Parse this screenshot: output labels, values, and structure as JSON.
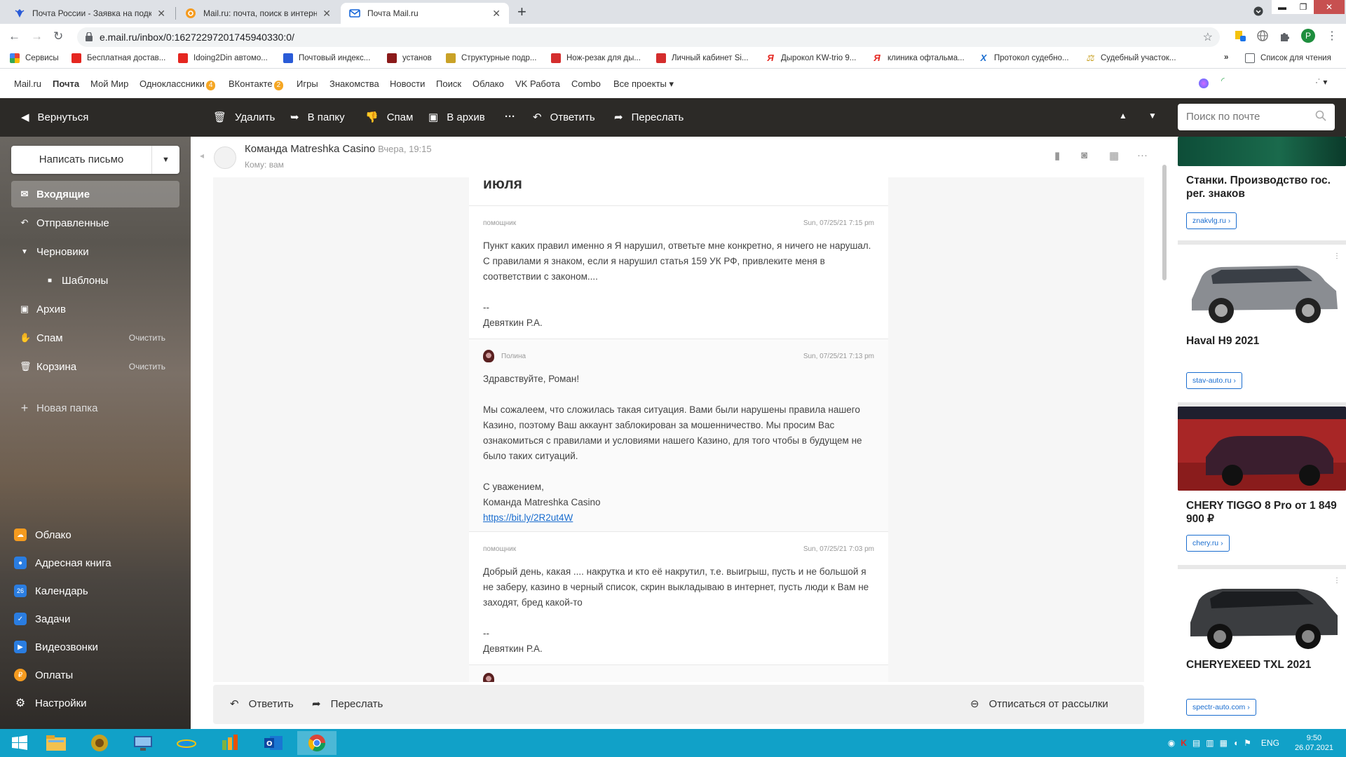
{
  "browser": {
    "tabs": [
      {
        "title": "Почта России - Заявка на подк",
        "icon": "post-icon"
      },
      {
        "title": "Mail.ru: почта, поиск в интерне",
        "icon": "mailru-icon"
      },
      {
        "title": "Почта Mail.ru",
        "icon": "mail-envelope-icon"
      }
    ],
    "new_tab": "+",
    "url": "e.mail.ru/inbox/0:16272297201745940330:0/",
    "profile_letter": "P",
    "bookmarks": [
      "Сервисы",
      "Бесплатная достав...",
      "Idoing2Din автомо...",
      "Почтовый индекс...",
      "установ",
      "Структурные подр...",
      "Нож-резак для ды...",
      "Личный кабинет Si...",
      "Дырокол KW-trio 9...",
      "клиника офтальма...",
      "Протокол судебно...",
      "Судебный участок..."
    ],
    "more_bookmarks": "»",
    "reading_list": "Список для чтения"
  },
  "portal": {
    "items": [
      "Mail.ru",
      "Почта",
      "Мой Мир",
      "Одноклассники",
      "ВКонтакте",
      "Игры",
      "Знакомства",
      "Новости",
      "Поиск",
      "Облако",
      "VK Работа",
      "Combo",
      "Все проекты ▾"
    ],
    "ok_badge": "4",
    "vk_badge": "2"
  },
  "toolbar": {
    "back": "Вернуться",
    "delete": "Удалить",
    "to_folder": "В папку",
    "spam": "Спам",
    "archive": "В архив",
    "more": "···",
    "reply": "Ответить",
    "forward": "Переслать",
    "search_placeholder": "Поиск по почте"
  },
  "sidebar": {
    "compose": "Написать письмо",
    "folders": [
      {
        "label": "Входящие",
        "icon": "✉"
      },
      {
        "label": "Отправленные",
        "icon": "↶"
      },
      {
        "label": "Черновики",
        "icon": "▼"
      },
      {
        "label": "Шаблоны",
        "icon": "■"
      },
      {
        "label": "Архив",
        "icon": "▣"
      },
      {
        "label": "Спам",
        "icon": "✋"
      },
      {
        "label": "Корзина",
        "icon": "🗑"
      }
    ],
    "clear_label": "Очистить",
    "new_folder": "Новая папка",
    "services": [
      {
        "label": "Облако",
        "color": "#f59b1f",
        "glyph": "☁"
      },
      {
        "label": "Адресная книга",
        "color": "#2a7de1",
        "glyph": "●"
      },
      {
        "label": "Календарь",
        "color": "#2a7de1",
        "glyph": "26"
      },
      {
        "label": "Задачи",
        "color": "#2a7de1",
        "glyph": "✓"
      },
      {
        "label": "Видеозвонки",
        "color": "#2a7de1",
        "glyph": "▶"
      },
      {
        "label": "Оплаты",
        "color": "#f59b1f",
        "glyph": "₽"
      },
      {
        "label": "Настройки",
        "color": "transparent",
        "glyph": "⚙"
      }
    ]
  },
  "letter": {
    "sender": "Команда Matreshka Casino",
    "date": "Вчера, 19:15",
    "to": "Кому: вам",
    "partial_heading": "июля",
    "messages": [
      {
        "author": "помощник",
        "time": "Sun, 07/25/21 7:15 pm",
        "avatar": false,
        "lines": [
          "Пункт каких правил именно я Я нарушил, ответьте мне конкретно, я ничего не нарушал. С правилами я знаком, если я нарушил статья 159 УК РФ, привлеките меня в соответствии с законом....",
          "",
          "--",
          "Девяткин Р.А."
        ]
      },
      {
        "author": "Полина",
        "time": "Sun, 07/25/21 7:13 pm",
        "avatar": true,
        "lines": [
          "Здравствуйте, Роман!",
          "",
          "Мы сожалеем, что сложилась такая ситуация. Вами были нарушены правила нашего Казино, поэтому Ваш аккаунт заблокирован за мошенничество. Мы просим Вас ознакомиться с правилами и условиями нашего Казино, для того чтобы в будущем не было таких ситуаций.",
          "",
          "С уважением,",
          "Команда Matreshka Casino"
        ],
        "link": "https://bit.ly/2R2ut4W"
      },
      {
        "author": "помощник",
        "time": "Sun, 07/25/21 7:03 pm",
        "avatar": false,
        "lines": [
          "Добрый день, какая .... накрутка и кто её накрутил, т.е. выигрыш, пусть и не большой я не заберу, казино в черный список, скрин выкладываю в интернет, пусть люди к Вам не заходят, бред какой-то",
          "",
          "--",
          "Девяткин Р.А."
        ]
      }
    ],
    "footer_reply": "Ответить",
    "footer_forward": "Переслать",
    "unsubscribe": "Отписаться от рассылки"
  },
  "ads": [
    {
      "title": "Станки. Производство гос. рег. знаков",
      "link": "znakvlg.ru"
    },
    {
      "title": "Haval H9 2021",
      "link": "stav-auto.ru"
    },
    {
      "title": "CHERY TIGGO 8 Pro от 1 849 900 ₽",
      "link": "chery.ru"
    },
    {
      "title": "CHERYEXEED TXL 2021",
      "link": "spectr-auto.com"
    }
  ],
  "taskbar": {
    "lang": "ENG",
    "time": "9:50",
    "date": "26.07.2021"
  }
}
